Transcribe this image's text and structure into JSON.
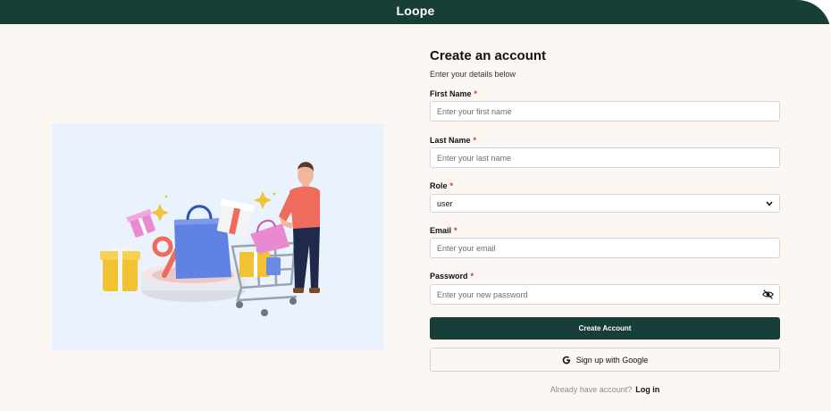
{
  "app": {
    "brand": "Loope"
  },
  "form": {
    "title": "Create an account",
    "subtitle": "Enter your details below",
    "first_name": {
      "label": "First Name",
      "required": "*",
      "placeholder": "Enter your first name"
    },
    "last_name": {
      "label": "Last Name",
      "required": "*",
      "placeholder": "Enter your last name"
    },
    "role": {
      "label": "Role",
      "required": "*",
      "value": "user"
    },
    "email": {
      "label": "Email",
      "required": "*",
      "placeholder": "Enter your email"
    },
    "password": {
      "label": "Password",
      "required": "*",
      "placeholder": "Enter your new password"
    },
    "submit_label": "Create Account",
    "google_label": "Sign up with Google",
    "login_prompt": "Already have account?",
    "login_link": "Log in"
  },
  "icons": {
    "password_toggle": "eye-slash-icon",
    "google": "google-icon",
    "select_arrow": "chevron-down-icon"
  },
  "colors": {
    "brand_dark": "#173f37",
    "page_bg": "#fdf7f3",
    "illustration_bg": "#eaf3fd",
    "required": "#c0392b"
  }
}
